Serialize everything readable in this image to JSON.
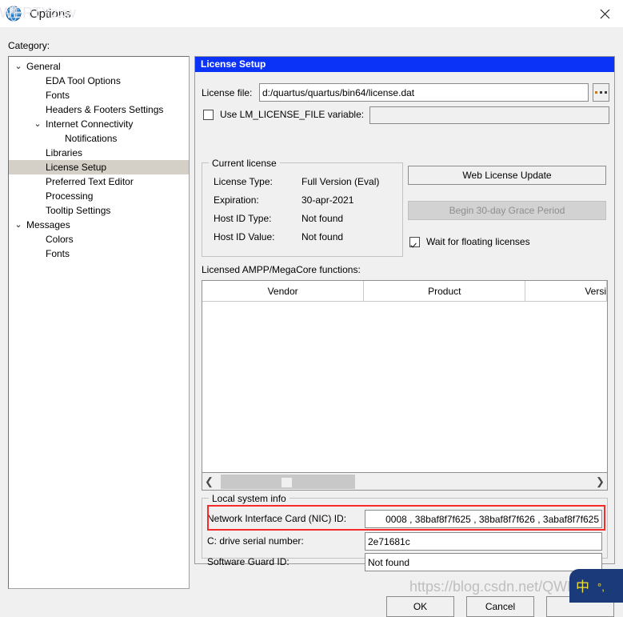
{
  "window": {
    "title": "Options",
    "app_icon": "globe-icon",
    "close_icon": "close-icon"
  },
  "category": {
    "label": "Category:",
    "tree": [
      {
        "label": "General",
        "depth": 0,
        "twisty": "⌄",
        "selected": false
      },
      {
        "label": "EDA Tool Options",
        "depth": 1,
        "twisty": "",
        "selected": false
      },
      {
        "label": "Fonts",
        "depth": 1,
        "twisty": "",
        "selected": false
      },
      {
        "label": "Headers & Footers Settings",
        "depth": 1,
        "twisty": "",
        "selected": false
      },
      {
        "label": "Internet Connectivity",
        "depth": 1,
        "twisty": "⌄",
        "selected": false
      },
      {
        "label": "Notifications",
        "depth": 2,
        "twisty": "",
        "selected": false
      },
      {
        "label": "Libraries",
        "depth": 1,
        "twisty": "",
        "selected": false
      },
      {
        "label": "License Setup",
        "depth": 1,
        "twisty": "",
        "selected": true
      },
      {
        "label": "Preferred Text Editor",
        "depth": 1,
        "twisty": "",
        "selected": false
      },
      {
        "label": "Processing",
        "depth": 1,
        "twisty": "",
        "selected": false
      },
      {
        "label": "Tooltip Settings",
        "depth": 1,
        "twisty": "",
        "selected": false
      },
      {
        "label": "Messages",
        "depth": 0,
        "twisty": "⌄",
        "selected": false
      },
      {
        "label": "Colors",
        "depth": 1,
        "twisty": "",
        "selected": false
      },
      {
        "label": "Fonts",
        "depth": 1,
        "twisty": "",
        "selected": false
      }
    ]
  },
  "panel": {
    "header": "License Setup",
    "license_file": {
      "label": "License file:",
      "value": "d:/quartus/quartus/bin64/license.dat",
      "browse_label": "..."
    },
    "lm_license": {
      "checkbox_label": "Use LM_LICENSE_FILE variable:",
      "checked": false,
      "value": ""
    },
    "current_license": {
      "title": "Current license",
      "rows": [
        {
          "label": "License Type:",
          "value": "Full Version (Eval)"
        },
        {
          "label": "Expiration:",
          "value": "30-apr-2021"
        },
        {
          "label": "Host ID Type:",
          "value": "Not found"
        },
        {
          "label": "Host ID Value:",
          "value": "Not found"
        }
      ]
    },
    "web_license_update_label": "Web License Update",
    "grace_period_label": "Begin 30-day Grace Period",
    "grace_period_enabled": false,
    "wait_floating": {
      "label": "Wait for floating licenses",
      "checked": true
    },
    "licensed_functions": {
      "label": "Licensed AMPP/MegaCore functions:",
      "columns": [
        "Vendor",
        "Product",
        "Versi"
      ],
      "rows": []
    },
    "scrollbar": {
      "left_arrow": "chevron-left-icon",
      "right_arrow": "chevron-right-icon"
    },
    "local_system_info": {
      "title": "Local system info",
      "rows": [
        {
          "label": "Network Interface Card (NIC) ID:",
          "value": "0008 , 38baf8f7f625 , 38baf8f7f626 , 3abaf8f7f625",
          "highlighted": true
        },
        {
          "label": "C: drive serial number:",
          "value": "2e71681c",
          "highlighted": false
        },
        {
          "label": "Software Guard ID:",
          "value": "Not found",
          "highlighted": false
        }
      ]
    }
  },
  "footer": {
    "ok_label": "OK",
    "cancel_label": "Cancel",
    "help_label": ""
  },
  "overlay": {
    "watermark": "https://blog.csdn.net/QWERTYzxw",
    "ime_mode": "中",
    "ime_punct": "°,"
  },
  "colors": {
    "panel_header": "#0b33f8",
    "highlight_red": "#f62b2b",
    "tree_selected": "#d4d0c8",
    "ime_blue": "#1b3a7a",
    "ime_yellow": "#f2e03a"
  }
}
